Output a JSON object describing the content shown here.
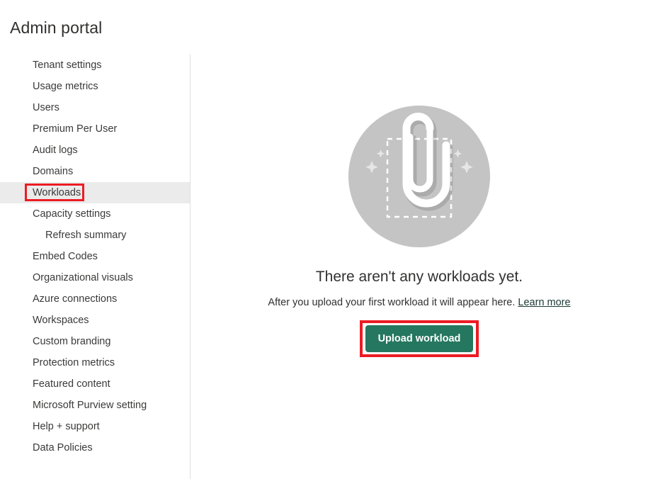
{
  "header": {
    "title": "Admin portal"
  },
  "sidebar": {
    "items": [
      {
        "label": "Tenant settings",
        "indented": false,
        "selected": false
      },
      {
        "label": "Usage metrics",
        "indented": false,
        "selected": false
      },
      {
        "label": "Users",
        "indented": false,
        "selected": false
      },
      {
        "label": "Premium Per User",
        "indented": false,
        "selected": false
      },
      {
        "label": "Audit logs",
        "indented": false,
        "selected": false
      },
      {
        "label": "Domains",
        "indented": false,
        "selected": false
      },
      {
        "label": "Workloads",
        "indented": false,
        "selected": true
      },
      {
        "label": "Capacity settings",
        "indented": false,
        "selected": false
      },
      {
        "label": "Refresh summary",
        "indented": true,
        "selected": false
      },
      {
        "label": "Embed Codes",
        "indented": false,
        "selected": false
      },
      {
        "label": "Organizational visuals",
        "indented": false,
        "selected": false
      },
      {
        "label": "Azure connections",
        "indented": false,
        "selected": false
      },
      {
        "label": "Workspaces",
        "indented": false,
        "selected": false
      },
      {
        "label": "Custom branding",
        "indented": false,
        "selected": false
      },
      {
        "label": "Protection metrics",
        "indented": false,
        "selected": false
      },
      {
        "label": "Featured content",
        "indented": false,
        "selected": false
      },
      {
        "label": "Microsoft Purview setting",
        "indented": false,
        "selected": false
      },
      {
        "label": "Help + support",
        "indented": false,
        "selected": false
      },
      {
        "label": "Data Policies",
        "indented": false,
        "selected": false
      }
    ]
  },
  "main": {
    "illustration_icon": "paperclip-attachment-icon",
    "empty_title": "There aren't any workloads yet.",
    "empty_subtitle_text": "After you upload your first workload it will appear here. ",
    "learn_more_label": "Learn more",
    "upload_button_label": "Upload workload"
  },
  "colors": {
    "accent_button": "#25775f",
    "annotation_red": "#ec1c24",
    "selected_row": "#ebebeb",
    "illustration_circle": "#c4c4c4",
    "divider": "#e1dfdd",
    "text": "#323130"
  },
  "annotations": [
    {
      "target": "sidebar-item-workloads",
      "color": "#ec1c24",
      "shape": "rectangle"
    },
    {
      "target": "upload-workload-button",
      "color": "#ec1c24",
      "shape": "rectangle"
    }
  ]
}
